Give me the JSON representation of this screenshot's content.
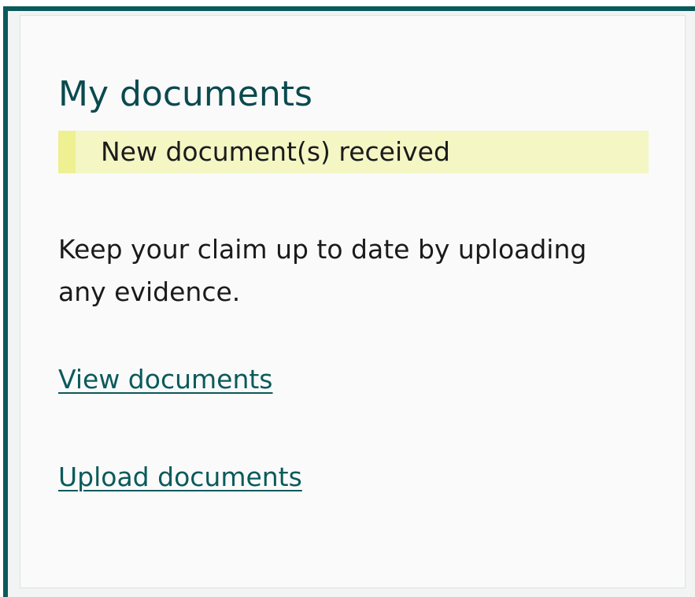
{
  "card": {
    "title": "My documents",
    "notification": "New document(s) received",
    "description": "Keep your claim up to date by uploading any evidence.",
    "links": {
      "view": "View documents",
      "upload": "Upload documents"
    }
  },
  "colors": {
    "accent": "#0b5a5b",
    "title": "#0b4a4f",
    "notification_bg": "#f4f6c4",
    "notification_bar": "#eef092",
    "text": "#1b1b1b"
  }
}
